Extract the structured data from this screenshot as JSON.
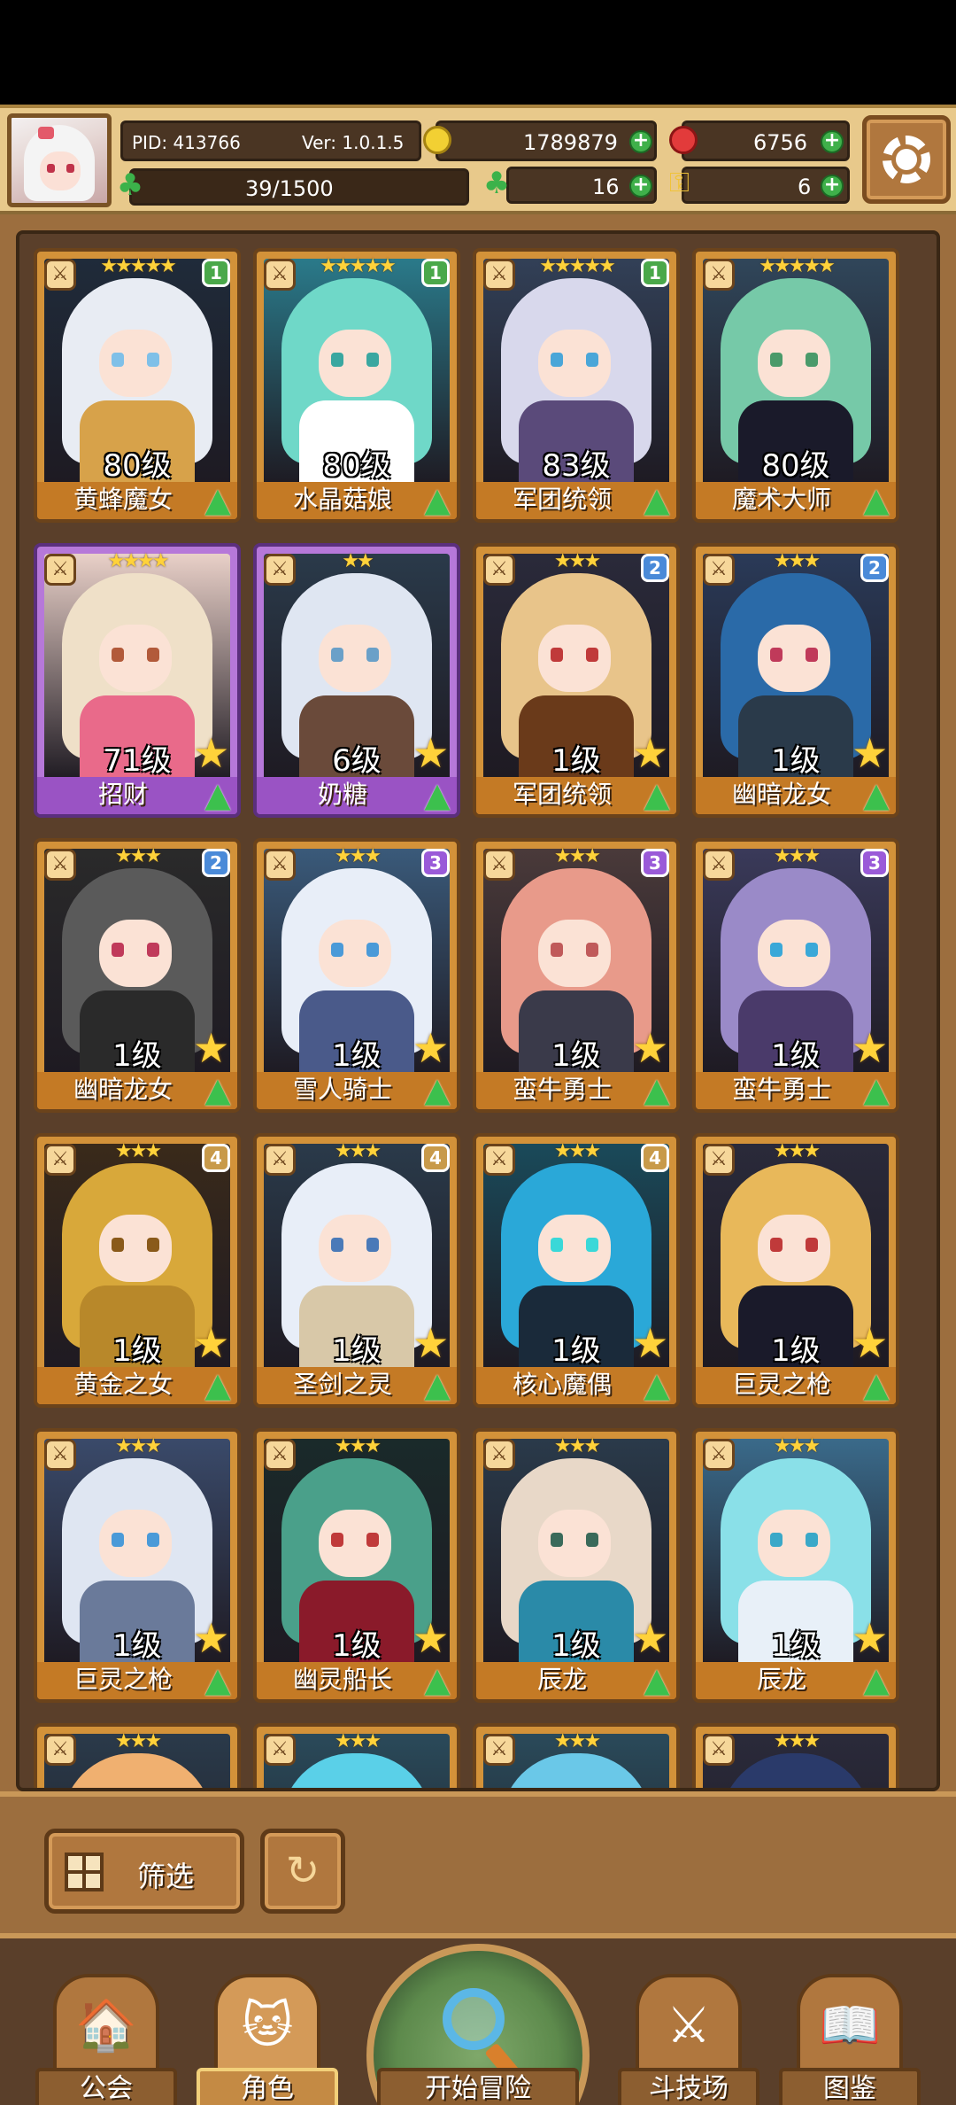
{
  "header": {
    "pid": "PID: 413766",
    "version": "Ver: 1.0.1.5",
    "gold": "1789879",
    "gems": "6756",
    "stamina": "39/1500",
    "clover_count": "16",
    "key_count": "6"
  },
  "cards": [
    {
      "stars": "★★★★★",
      "badge": "1",
      "badge_color": "#4aa84a",
      "level": "80级",
      "name": "黄蜂魔女",
      "frame": "gold",
      "art": [
        "#1f2b3a",
        "#e8ecf3",
        "#d7a24a",
        "#7fc0e8"
      ],
      "big_star": false
    },
    {
      "stars": "★★★★★",
      "badge": "1",
      "badge_color": "#4aa84a",
      "level": "80级",
      "name": "水晶菇娘",
      "frame": "gold",
      "art": [
        "#2a7a8a",
        "#6fd8c8",
        "#ffffff",
        "#3aa7a0"
      ],
      "big_star": false
    },
    {
      "stars": "★★★★★",
      "badge": "1",
      "badge_color": "#4aa84a",
      "level": "83级",
      "name": "军团统领",
      "frame": "gold",
      "art": [
        "#324057",
        "#d8d8ec",
        "#5a4a7a",
        "#4aa6d8"
      ],
      "big_star": false
    },
    {
      "stars": "★★★★★",
      "badge": "",
      "badge_color": "",
      "level": "80级",
      "name": "魔术大师",
      "frame": "gold",
      "art": [
        "#30465a",
        "#76c9a8",
        "#1a1a2a",
        "#4a9a6a"
      ],
      "big_star": false
    },
    {
      "stars": "★★★★",
      "badge": "",
      "badge_color": "",
      "level": "71级",
      "name": "招财",
      "frame": "purple",
      "art": [
        "#e9d0c8",
        "#efe0c8",
        "#e96a8a",
        "#b25a3a"
      ],
      "big_star": true
    },
    {
      "stars": "★★",
      "badge": "",
      "badge_color": "",
      "level": "6级",
      "name": "奶糖",
      "frame": "purple",
      "art": [
        "#2a3a4a",
        "#dfe6f2",
        "#6a4a3a",
        "#6aa0c8"
      ],
      "big_star": true
    },
    {
      "stars": "★★★",
      "badge": "2",
      "badge_color": "#4a8ad8",
      "level": "1级",
      "name": "军团统领",
      "frame": "gold",
      "art": [
        "#2a2a3a",
        "#e8c48a",
        "#6a3a1a",
        "#c03a3a"
      ],
      "big_star": true
    },
    {
      "stars": "★★★",
      "badge": "2",
      "badge_color": "#4a8ad8",
      "level": "1级",
      "name": "幽暗龙女",
      "frame": "gold",
      "art": [
        "#2a3a58",
        "#2a6aa8",
        "#2a3a4a",
        "#c03a5a"
      ],
      "big_star": true
    },
    {
      "stars": "★★★",
      "badge": "2",
      "badge_color": "#4a8ad8",
      "level": "1级",
      "name": "幽暗龙女",
      "frame": "gold",
      "art": [
        "#2a2a2a",
        "#5a5a5a",
        "#2a2a2a",
        "#c03a5a"
      ],
      "big_star": true
    },
    {
      "stars": "★★★",
      "badge": "3",
      "badge_color": "#9a5ad8",
      "level": "1级",
      "name": "雪人骑士",
      "frame": "gold",
      "art": [
        "#3a5a7a",
        "#e8eef8",
        "#4a5a8a",
        "#4a9ad8"
      ],
      "big_star": true
    },
    {
      "stars": "★★★",
      "badge": "3",
      "badge_color": "#9a5ad8",
      "level": "1级",
      "name": "蛮牛勇士",
      "frame": "gold",
      "art": [
        "#4a3a3a",
        "#e89a8a",
        "#3a3a4a",
        "#c05a5a"
      ],
      "big_star": true
    },
    {
      "stars": "★★★",
      "badge": "3",
      "badge_color": "#9a5ad8",
      "level": "1级",
      "name": "蛮牛勇士",
      "frame": "gold",
      "art": [
        "#3a3a5a",
        "#9a8ac8",
        "#4a3a6a",
        "#3aa8d8"
      ],
      "big_star": true
    },
    {
      "stars": "★★★",
      "badge": "4",
      "badge_color": "#c89a4a",
      "level": "1级",
      "name": "黄金之女",
      "frame": "gold",
      "art": [
        "#3a2a1a",
        "#d8a83a",
        "#b8882a",
        "#8a5a1a"
      ],
      "big_star": true
    },
    {
      "stars": "★★★",
      "badge": "4",
      "badge_color": "#c89a4a",
      "level": "1级",
      "name": "圣剑之灵",
      "frame": "gold",
      "art": [
        "#2a3a4a",
        "#e8eef8",
        "#d8c8a8",
        "#4a7ab8"
      ],
      "big_star": true
    },
    {
      "stars": "★★★",
      "badge": "4",
      "badge_color": "#c89a4a",
      "level": "1级",
      "name": "核心魔偶",
      "frame": "gold",
      "art": [
        "#1a4a5a",
        "#2aa8d8",
        "#1a2a3a",
        "#3ad8d8"
      ],
      "big_star": true
    },
    {
      "stars": "★★★",
      "badge": "",
      "badge_color": "",
      "level": "1级",
      "name": "巨灵之枪",
      "frame": "gold",
      "art": [
        "#2a2a3a",
        "#e8b85a",
        "#1a1a2a",
        "#c03a3a"
      ],
      "big_star": true
    },
    {
      "stars": "★★★",
      "badge": "",
      "badge_color": "",
      "level": "1级",
      "name": "巨灵之枪",
      "frame": "gold",
      "art": [
        "#3a4a6a",
        "#dfe6f2",
        "#6a7a9a",
        "#4a9ad8"
      ],
      "big_star": true
    },
    {
      "stars": "★★★",
      "badge": "",
      "badge_color": "",
      "level": "1级",
      "name": "幽灵船长",
      "frame": "gold",
      "art": [
        "#1a2a2a",
        "#4aa08a",
        "#8a1a2a",
        "#c03a3a"
      ],
      "big_star": true
    },
    {
      "stars": "★★★",
      "badge": "",
      "badge_color": "",
      "level": "1级",
      "name": "辰龙",
      "frame": "gold",
      "art": [
        "#2a3a4a",
        "#e8d8c8",
        "#2a8aa8",
        "#3a6a5a"
      ],
      "big_star": true
    },
    {
      "stars": "★★★",
      "badge": "",
      "badge_color": "",
      "level": "1级",
      "name": "辰龙",
      "frame": "gold",
      "art": [
        "#3a6a8a",
        "#8ae0e8",
        "#e8f0f8",
        "#3aa8c8"
      ],
      "big_star": true
    },
    {
      "stars": "★★★",
      "badge": "",
      "badge_color": "",
      "level": "",
      "name": "",
      "frame": "gold",
      "art": [
        "#2a3a4a",
        "#f0b070",
        "#e88a4a",
        "#c03a3a"
      ],
      "big_star": false
    },
    {
      "stars": "★★★",
      "badge": "",
      "badge_color": "",
      "level": "",
      "name": "",
      "frame": "gold",
      "art": [
        "#2a4a5a",
        "#5ad0e8",
        "#8ae8f0",
        "#3aa8c8"
      ],
      "big_star": false
    },
    {
      "stars": "★★★",
      "badge": "",
      "badge_color": "",
      "level": "",
      "name": "",
      "frame": "gold",
      "art": [
        "#2a4a5a",
        "#6ac8e8",
        "#4a9ac8",
        "#3aa8c8"
      ],
      "big_star": false
    },
    {
      "stars": "★★★",
      "badge": "",
      "badge_color": "",
      "level": "",
      "name": "",
      "frame": "gold",
      "art": [
        "#2a2a3a",
        "#2a3a6a",
        "#e8c878",
        "#3a4a8a"
      ],
      "big_star": false
    }
  ],
  "toolbar": {
    "filter_label": "筛选",
    "refresh_icon": "refresh-icon"
  },
  "nav": {
    "guild": "公会",
    "characters": "角色",
    "adventure": "开始冒险",
    "arena": "斗技场",
    "codex": "图鉴"
  }
}
